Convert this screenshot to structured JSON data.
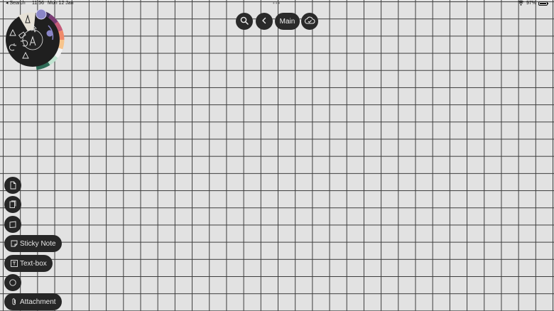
{
  "status_bar": {
    "back_label": "◂ Search",
    "time": "11:56",
    "date": "Mon 12 Jan",
    "battery": "97%",
    "battery_level": 0.97,
    "multitask_dots": "•••"
  },
  "top_toolbar": {
    "search_icon": "search-icon",
    "back_icon": "chevron-left-icon",
    "notebook_label": "Main",
    "sync_icon": "cloud-sync-icon"
  },
  "tool_wheel": {
    "tools": [
      "pen-icon",
      "cursor-icon",
      "eraser-icon",
      "text-icon",
      "undo-icon",
      "redo-icon",
      "lasso-icon",
      "shape-icon"
    ],
    "colors": [
      "#8a86c8",
      "#3a2a55",
      "#7b3b73",
      "#c45a78",
      "#f08a6a",
      "#f7c48c",
      "#f2f2f2",
      "#bfe3d0",
      "#2f6b57"
    ]
  },
  "insert_menu": {
    "page_icon": "page-icon",
    "template_icon": "template-icon",
    "frame_icon": "frame-icon",
    "sticky_note": "Sticky Note",
    "text_box": "Text-box",
    "shape_icon": "circle-shape-icon",
    "attachment": "Attachment"
  }
}
